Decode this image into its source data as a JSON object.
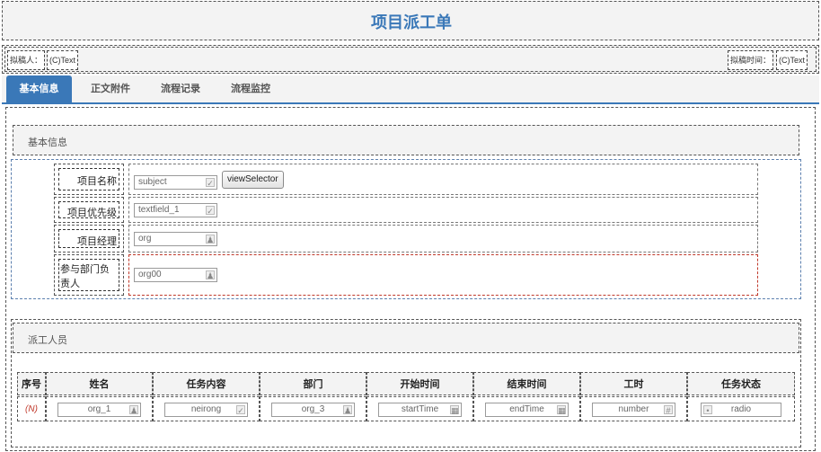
{
  "title": "项目派工单",
  "meta": {
    "drafter_label": "拟稿人：",
    "drafter_value": "(C)Text",
    "draft_time_label": "拟稿时间：",
    "draft_time_value": "(C)Text"
  },
  "tabs": [
    {
      "label": "基本信息",
      "active": true
    },
    {
      "label": "正文附件",
      "active": false
    },
    {
      "label": "流程记录",
      "active": false
    },
    {
      "label": "流程监控",
      "active": false
    }
  ],
  "basic_section": {
    "header": "基本信息",
    "rows": [
      {
        "label": "项目名称",
        "input": "subject",
        "icon": "edit-icon"
      },
      {
        "label": "项目优先级",
        "input": "textfield_1",
        "icon": "edit-icon"
      },
      {
        "label": "项目经理",
        "input": "org",
        "icon": "user-icon"
      },
      {
        "label": "参与部门负责人",
        "input": "org00",
        "icon": "user-icon"
      }
    ],
    "view_selector_button": "viewSelector"
  },
  "dispatch_section": {
    "header": "派工人员",
    "columns": [
      "序号",
      "姓名",
      "任务内容",
      "部门",
      "开始时间",
      "结束时间",
      "工时",
      "任务状态"
    ],
    "row": {
      "index": "(N)",
      "name": "org_1",
      "task": "neirong",
      "dept": "org_3",
      "start": "startTime",
      "end": "endTime",
      "hours": "number",
      "status": "radio"
    }
  }
}
